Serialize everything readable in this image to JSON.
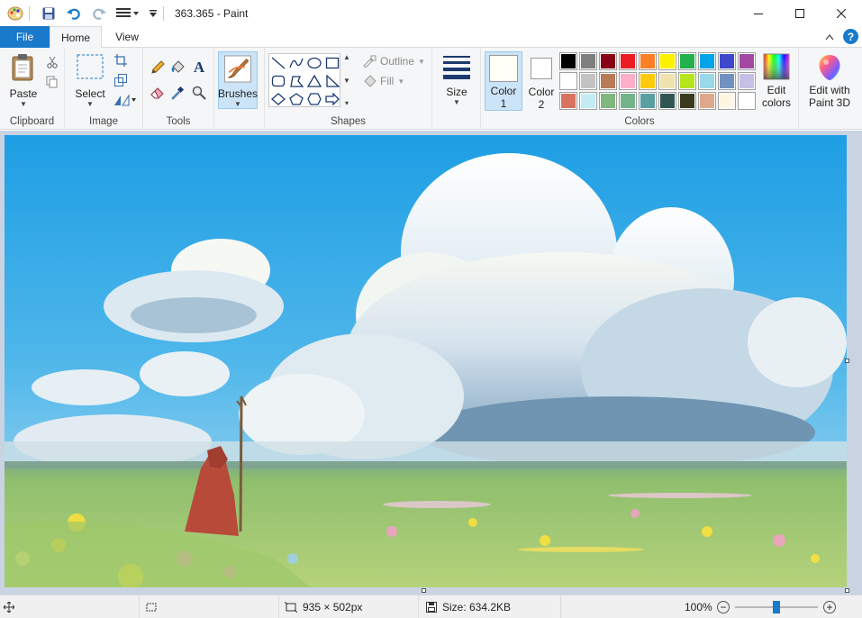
{
  "window": {
    "title": "363.365 - Paint"
  },
  "tabs": {
    "file": "File",
    "home": "Home",
    "view": "View"
  },
  "ribbon": {
    "clipboard": {
      "label": "Clipboard",
      "paste": "Paste"
    },
    "image": {
      "label": "Image",
      "select": "Select"
    },
    "tools": {
      "label": "Tools"
    },
    "brushes": {
      "label": "Brushes"
    },
    "shapes": {
      "label": "Shapes",
      "outline": "Outline",
      "fill": "Fill"
    },
    "size": {
      "label": "Size"
    },
    "colors": {
      "label": "Colors",
      "color1_line1": "Color",
      "color1_line2": "1",
      "color2_line1": "Color",
      "color2_line2": "2",
      "edit_line1": "Edit",
      "edit_line2": "colors",
      "color1_value": "#fffff5",
      "color2_value": "#ffffff",
      "palette_row1": [
        "#000000",
        "#7f7f7f",
        "#880015",
        "#ed1c24",
        "#ff7f27",
        "#fff200",
        "#22b14c",
        "#00a2e8",
        "#3f48cc",
        "#a349a4"
      ],
      "palette_row2": [
        "#ffffff",
        "#c3c3c3",
        "#b97a57",
        "#ffaec9",
        "#ffc90e",
        "#efe4b0",
        "#b5e61d",
        "#99d9ea",
        "#7092be",
        "#c8bfe7"
      ],
      "palette_row3": [
        "#d9735f",
        "#c5ecf4",
        "#7fb77e",
        "#74b48a",
        "#5aa0a3",
        "#2f5653",
        "#3a3a1e",
        "#e0a88a",
        "#fff7e2",
        "#ffffff"
      ]
    },
    "paint3d": {
      "line1": "Edit with",
      "line2": "Paint 3D"
    }
  },
  "status": {
    "dimensions": "935 × 502px",
    "size": "Size: 634.2KB",
    "zoom": "100%",
    "zoom_minus": "−",
    "zoom_plus": "+",
    "zoom_level": 0.5
  },
  "colors": {
    "accent": "#1979ca",
    "ribbon_bg": "#f5f6f7",
    "workspace_bg": "#c9d3e2",
    "selected_bg": "#cce4f7"
  },
  "icons": {
    "save": "save-icon",
    "undo": "undo-icon",
    "redo": "redo-icon",
    "help": "help-icon"
  }
}
